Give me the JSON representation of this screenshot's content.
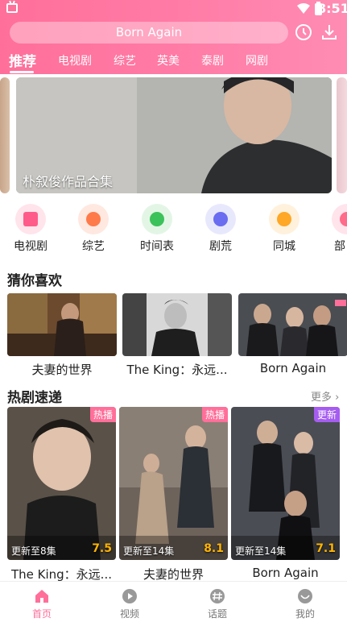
{
  "status_bar": {
    "time": "8:51"
  },
  "search": {
    "value": "Born Again"
  },
  "tabs": [
    "推荐",
    "电视剧",
    "综艺",
    "英美",
    "泰剧",
    "网剧"
  ],
  "banner": {
    "title": "朴叙俊作品合集"
  },
  "quick_links": [
    {
      "label": "电视剧",
      "icon": "tv-icon",
      "color": "#ff5b8a"
    },
    {
      "label": "综艺",
      "icon": "mic-icon",
      "color": "#ff7a4a"
    },
    {
      "label": "时间表",
      "icon": "clock-icon",
      "color": "#3cc25a"
    },
    {
      "label": "剧荒",
      "icon": "compass-icon",
      "color": "#6a6df0"
    },
    {
      "label": "同城",
      "icon": "location-icon",
      "color": "#ffa726"
    },
    {
      "label": "部",
      "icon": "more-icon",
      "color": "#ff6b8a"
    }
  ],
  "recommend": {
    "title": "猜你喜欢",
    "items": [
      {
        "title": "夫妻的世界"
      },
      {
        "title": "The King：永远..."
      },
      {
        "title": "Born Again"
      }
    ]
  },
  "hot": {
    "title": "热剧速递",
    "more": "更多",
    "items": [
      {
        "title": "The King：永远...",
        "badge": "热播",
        "badge_color": "#ff6f9a",
        "update": "更新至8集",
        "score": "7.5"
      },
      {
        "title": "夫妻的世界",
        "badge": "热播",
        "badge_color": "#ff6f9a",
        "update": "更新至14集",
        "score": "8.1"
      },
      {
        "title": "Born Again",
        "badge": "更新",
        "badge_color": "#a55cf0",
        "update": "更新至14集",
        "score": "7.1"
      }
    ]
  },
  "bottom_nav": [
    {
      "label": "首页",
      "active": true
    },
    {
      "label": "视频",
      "active": false
    },
    {
      "label": "话题",
      "active": false
    },
    {
      "label": "我的",
      "active": false
    }
  ],
  "colors": {
    "accent": "#ff6f9a",
    "score": "#ffb400"
  }
}
